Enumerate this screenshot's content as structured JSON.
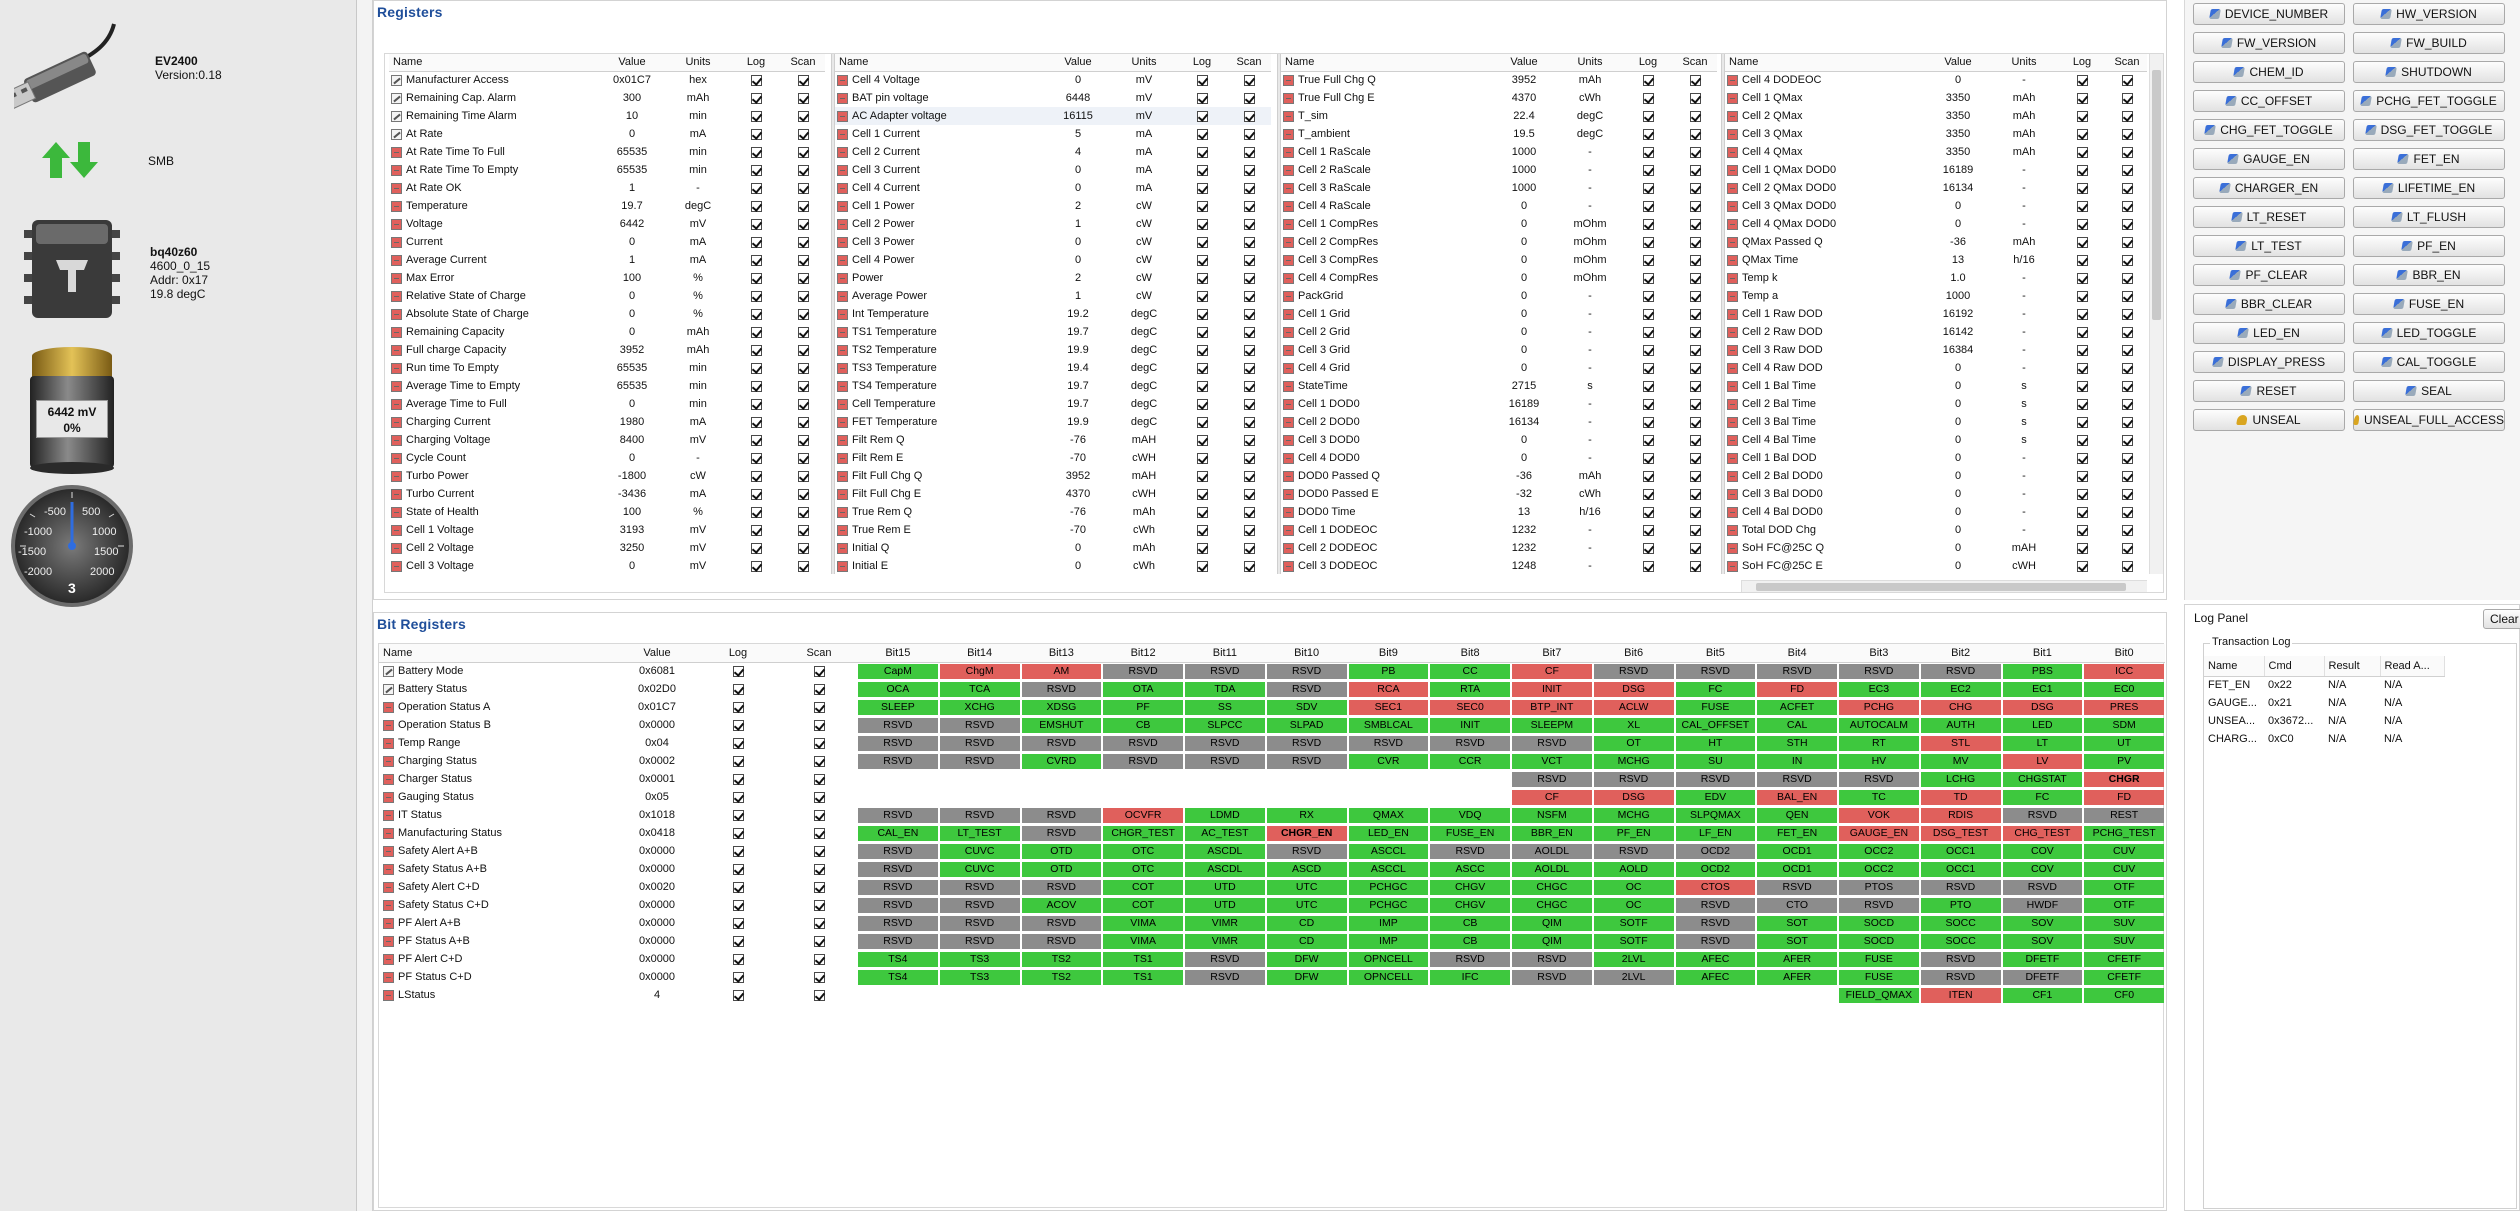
{
  "device": {
    "name": "EV2400",
    "version": "Version:0.18",
    "bus": "SMB",
    "chip": "bq40z60",
    "chip_ver": "4600_0_15",
    "addr": "Addr: 0x17",
    "temp": "19.8 degC",
    "battery_mv": "6442 mV",
    "battery_pct": "0%",
    "battery_level": 0,
    "gauge": {
      "labels": [
        "-500",
        "500",
        "-1000",
        "1000",
        "-1500",
        "1500",
        "-2000",
        "2000"
      ],
      "center": "3"
    }
  },
  "registers": {
    "title": "Registers",
    "headers": [
      "Name",
      "Value",
      "Units",
      "Log",
      "Scan"
    ],
    "cols": [
      [
        [
          "Manufacturer Access",
          "0x01C7",
          "hex"
        ],
        [
          "Remaining Cap. Alarm",
          "300",
          "mAh"
        ],
        [
          "Remaining Time Alarm",
          "10",
          "min"
        ],
        [
          "At Rate",
          "0",
          "mA"
        ],
        [
          "At Rate Time To Full",
          "65535",
          "min"
        ],
        [
          "At Rate Time To Empty",
          "65535",
          "min"
        ],
        [
          "At Rate OK",
          "1",
          "-"
        ],
        [
          "Temperature",
          "19.7",
          "degC"
        ],
        [
          "Voltage",
          "6442",
          "mV"
        ],
        [
          "Current",
          "0",
          "mA"
        ],
        [
          "Average Current",
          "1",
          "mA"
        ],
        [
          "Max Error",
          "100",
          "%"
        ],
        [
          "Relative State of Charge",
          "0",
          "%"
        ],
        [
          "Absolute State of Charge",
          "0",
          "%"
        ],
        [
          "Remaining Capacity",
          "0",
          "mAh"
        ],
        [
          "Full charge Capacity",
          "3952",
          "mAh"
        ],
        [
          "Run time To Empty",
          "65535",
          "min"
        ],
        [
          "Average Time to Empty",
          "65535",
          "min"
        ],
        [
          "Average Time to Full",
          "0",
          "min"
        ],
        [
          "Charging Current",
          "1980",
          "mA"
        ],
        [
          "Charging Voltage",
          "8400",
          "mV"
        ],
        [
          "Cycle Count",
          "0",
          "-"
        ],
        [
          "Turbo Power",
          "-1800",
          "cW"
        ],
        [
          "Turbo Current",
          "-3436",
          "mA"
        ],
        [
          "State of Health",
          "100",
          "%"
        ],
        [
          "Cell 1 Voltage",
          "3193",
          "mV"
        ],
        [
          "Cell 2 Voltage",
          "3250",
          "mV"
        ],
        [
          "Cell 3 Voltage",
          "0",
          "mV"
        ]
      ],
      [
        [
          "Cell 4 Voltage",
          "0",
          "mV"
        ],
        [
          "BAT pin voltage",
          "6448",
          "mV"
        ],
        [
          "AC Adapter voltage",
          "16115",
          "mV"
        ],
        [
          "Cell 1 Current",
          "5",
          "mA"
        ],
        [
          "Cell 2 Current",
          "4",
          "mA"
        ],
        [
          "Cell 3 Current",
          "0",
          "mA"
        ],
        [
          "Cell 4 Current",
          "0",
          "mA"
        ],
        [
          "Cell 1 Power",
          "2",
          "cW"
        ],
        [
          "Cell 2 Power",
          "1",
          "cW"
        ],
        [
          "Cell 3 Power",
          "0",
          "cW"
        ],
        [
          "Cell 4 Power",
          "0",
          "cW"
        ],
        [
          "Power",
          "2",
          "cW"
        ],
        [
          "Average Power",
          "1",
          "cW"
        ],
        [
          "Int Temperature",
          "19.2",
          "degC"
        ],
        [
          "TS1 Temperature",
          "19.7",
          "degC"
        ],
        [
          "TS2 Temperature",
          "19.9",
          "degC"
        ],
        [
          "TS3 Temperature",
          "19.4",
          "degC"
        ],
        [
          "TS4 Temperature",
          "19.7",
          "degC"
        ],
        [
          "Cell Temperature",
          "19.7",
          "degC"
        ],
        [
          "FET Temperature",
          "19.9",
          "degC"
        ],
        [
          "Filt Rem Q",
          "-76",
          "mAH"
        ],
        [
          "Filt Rem E",
          "-70",
          "cWH"
        ],
        [
          "Filt Full Chg Q",
          "3952",
          "mAH"
        ],
        [
          "Filt Full Chg E",
          "4370",
          "cWH"
        ],
        [
          "True Rem Q",
          "-76",
          "mAh"
        ],
        [
          "True Rem E",
          "-70",
          "cWh"
        ],
        [
          "Initial Q",
          "0",
          "mAh"
        ],
        [
          "Initial E",
          "0",
          "cWh"
        ]
      ],
      [
        [
          "True Full Chg Q",
          "3952",
          "mAh"
        ],
        [
          "True Full Chg E",
          "4370",
          "cWh"
        ],
        [
          "T_sim",
          "22.4",
          "degC"
        ],
        [
          "T_ambient",
          "19.5",
          "degC"
        ],
        [
          "Cell 1 RaScale",
          "1000",
          "-"
        ],
        [
          "Cell 2 RaScale",
          "1000",
          "-"
        ],
        [
          "Cell 3 RaScale",
          "1000",
          "-"
        ],
        [
          "Cell 4 RaScale",
          "0",
          "-"
        ],
        [
          "Cell 1 CompRes",
          "0",
          "mOhm"
        ],
        [
          "Cell 2 CompRes",
          "0",
          "mOhm"
        ],
        [
          "Cell 3 CompRes",
          "0",
          "mOhm"
        ],
        [
          "Cell 4 CompRes",
          "0",
          "mOhm"
        ],
        [
          "PackGrid",
          "0",
          "-"
        ],
        [
          "Cell 1 Grid",
          "0",
          "-"
        ],
        [
          "Cell 2 Grid",
          "0",
          "-"
        ],
        [
          "Cell 3 Grid",
          "0",
          "-"
        ],
        [
          "Cell 4 Grid",
          "0",
          "-"
        ],
        [
          "StateTime",
          "2715",
          "s"
        ],
        [
          "Cell 1 DOD0",
          "16189",
          "-"
        ],
        [
          "Cell 2 DOD0",
          "16134",
          "-"
        ],
        [
          "Cell 3 DOD0",
          "0",
          "-"
        ],
        [
          "Cell 4 DOD0",
          "0",
          "-"
        ],
        [
          "DOD0 Passed Q",
          "-36",
          "mAh"
        ],
        [
          "DOD0 Passed E",
          "-32",
          "cWh"
        ],
        [
          "DOD0 Time",
          "13",
          "h/16"
        ],
        [
          "Cell 1 DODEOC",
          "1232",
          "-"
        ],
        [
          "Cell 2 DODEOC",
          "1232",
          "-"
        ],
        [
          "Cell 3 DODEOC",
          "1248",
          "-"
        ]
      ],
      [
        [
          "Cell 4 DODEOC",
          "0",
          "-"
        ],
        [
          "Cell 1 QMax",
          "3350",
          "mAh"
        ],
        [
          "Cell 2 QMax",
          "3350",
          "mAh"
        ],
        [
          "Cell 3 QMax",
          "3350",
          "mAh"
        ],
        [
          "Cell 4 QMax",
          "3350",
          "mAh"
        ],
        [
          "Cell 1 QMax DOD0",
          "16189",
          "-"
        ],
        [
          "Cell 2 QMax DOD0",
          "16134",
          "-"
        ],
        [
          "Cell 3 QMax DOD0",
          "0",
          "-"
        ],
        [
          "Cell 4 QMax DOD0",
          "0",
          "-"
        ],
        [
          "QMax Passed Q",
          "-36",
          "mAh"
        ],
        [
          "QMax Time",
          "13",
          "h/16"
        ],
        [
          "Temp k",
          "1.0",
          "-"
        ],
        [
          "Temp a",
          "1000",
          "-"
        ],
        [
          "Cell 1 Raw DOD",
          "16192",
          "-"
        ],
        [
          "Cell 2 Raw DOD",
          "16142",
          "-"
        ],
        [
          "Cell 3 Raw DOD",
          "16384",
          "-"
        ],
        [
          "Cell 4 Raw DOD",
          "0",
          "-"
        ],
        [
          "Cell 1 Bal Time",
          "0",
          "s"
        ],
        [
          "Cell 2 Bal Time",
          "0",
          "s"
        ],
        [
          "Cell 3 Bal Time",
          "0",
          "s"
        ],
        [
          "Cell 4 Bal Time",
          "0",
          "s"
        ],
        [
          "Cell 1 Bal DOD",
          "0",
          "-"
        ],
        [
          "Cell 2 Bal DOD0",
          "0",
          "-"
        ],
        [
          "Cell 3 Bal DOD0",
          "0",
          "-"
        ],
        [
          "Cell 4 Bal DOD0",
          "0",
          "-"
        ],
        [
          "Total DOD Chg",
          "0",
          "-"
        ],
        [
          "SoH FC@25C Q",
          "0",
          "mAH"
        ],
        [
          "SoH FC@25C E",
          "0",
          "cWH"
        ]
      ]
    ]
  },
  "bitregs": {
    "title": "Bit Registers",
    "headers": [
      "Name",
      "Value",
      "Log",
      "Scan",
      "Bit15",
      "Bit14",
      "Bit13",
      "Bit12",
      "Bit11",
      "Bit10",
      "Bit9",
      "Bit8",
      "Bit7",
      "Bit6",
      "Bit5",
      "Bit4",
      "Bit3",
      "Bit2",
      "Bit1",
      "Bit0"
    ],
    "rows": [
      {
        "name": "Battery Mode",
        "value": "0x6081",
        "bits": [
          "CapM",
          "ChgM",
          "AM",
          "RSVD",
          "RSVD",
          "RSVD",
          "PB",
          "CC",
          "CF",
          "RSVD",
          "RSVD",
          "RSVD",
          "RSVD",
          "RSVD",
          "PBS",
          "ICC"
        ],
        "st": "grrggyggryyyyygr"
      },
      {
        "name": "Battery Status",
        "value": "0x02D0",
        "bits": [
          "OCA",
          "TCA",
          "RSVD",
          "OTA",
          "TDA",
          "RSVD",
          "RCA",
          "RTA",
          "INIT",
          "DSG",
          "FC",
          "FD",
          "EC3",
          "EC2",
          "EC1",
          "EC0"
        ],
        "st": "ggyggyrgrrgrgggg"
      },
      {
        "name": "Operation Status A",
        "value": "0x01C7",
        "bits": [
          "SLEEP",
          "XCHG",
          "XDSG",
          "PF",
          "SS",
          "SDV",
          "SEC1",
          "SEC0",
          "BTP_INT",
          "ACLW",
          "FUSE",
          "ACFET",
          "PCHG",
          "CHG",
          "DSG",
          "PRES"
        ],
        "st": "ggggggrrrrggrrrr"
      },
      {
        "name": "Operation Status B",
        "value": "0x0000",
        "bits": [
          "RSVD",
          "RSVD",
          "EMSHUT",
          "CB",
          "SLPCC",
          "SLPAD",
          "SMBLCAL",
          "INIT",
          "SLEEPM",
          "XL",
          "CAL_OFFSET",
          "CAL",
          "AUTOCALM",
          "AUTH",
          "LED",
          "SDM"
        ],
        "st": "yyggggggggggggggg"
      },
      {
        "name": "Temp Range",
        "value": "0x04",
        "bits": [
          "RSVD",
          "RSVD",
          "RSVD",
          "RSVD",
          "RSVD",
          "RSVD",
          "RSVD",
          "RSVD",
          "RSVD",
          "OT",
          "HT",
          "STH",
          "RT",
          "STL",
          "LT",
          "UT"
        ],
        "st": "yyyyyyyyyggggrgg"
      },
      {
        "name": "Charging Status",
        "value": "0x0002",
        "bits": [
          "RSVD",
          "RSVD",
          "CVRD",
          "RSVD",
          "RSVD",
          "RSVD",
          "CVR",
          "CCR",
          "VCT",
          "MCHG",
          "SU",
          "IN",
          "HV",
          "MV",
          "LV",
          "PV"
        ],
        "st": "yygyyyggggggggrg"
      },
      {
        "name": "Charger Status",
        "value": "0x0001",
        "bits": [
          "",
          "",
          "",
          "",
          "",
          "",
          "",
          "",
          "RSVD",
          "RSVD",
          "RSVD",
          "RSVD",
          "RSVD",
          "LCHG",
          "CHGSTAT",
          "CHGR"
        ],
        "st": "eeeeeeeeyyyyyggR"
      },
      {
        "name": "Gauging Status",
        "value": "0x05",
        "bits": [
          "",
          "",
          "",
          "",
          "",
          "",
          "",
          "",
          "CF",
          "DSG",
          "EDV",
          "BAL_EN",
          "TC",
          "TD",
          "FC",
          "FD"
        ],
        "st": "eeeeeeeerrgrgrgr"
      },
      {
        "name": "IT Status",
        "value": "0x1018",
        "bits": [
          "RSVD",
          "RSVD",
          "RSVD",
          "OCVFR",
          "LDMD",
          "RX",
          "QMAX",
          "VDQ",
          "NSFM",
          "MCHG",
          "SLPQMAX",
          "QEN",
          "VOK",
          "RDIS",
          "RSVD",
          "REST"
        ],
        "st": "yyyrggggggggrrgyg"
      },
      {
        "name": "Manufacturing Status",
        "value": "0x0418",
        "bits": [
          "CAL_EN",
          "LT_TEST",
          "RSVD",
          "CHGR_TEST",
          "AC_TEST",
          "CHGR_EN",
          "LED_EN",
          "FUSE_EN",
          "BBR_EN",
          "PF_EN",
          "LF_EN",
          "FET_EN",
          "GAUGE_EN",
          "DSG_TEST",
          "CHG_TEST",
          "PCHG_TEST"
        ],
        "st": "ggyggRggggggrrrggg"
      },
      {
        "name": "Safety Alert A+B",
        "value": "0x0000",
        "bits": [
          "RSVD",
          "CUVC",
          "OTD",
          "OTC",
          "ASCDL",
          "RSVD",
          "ASCCL",
          "RSVD",
          "AOLDL",
          "RSVD",
          "OCD2",
          "OCD1",
          "OCC2",
          "OCC1",
          "COV",
          "CUV"
        ],
        "st": "yggggyggygyggggg"
      },
      {
        "name": "Safety Status A+B",
        "value": "0x0000",
        "bits": [
          "RSVD",
          "CUVC",
          "OTD",
          "OTC",
          "ASCDL",
          "ASCD",
          "ASCCL",
          "ASCC",
          "AOLDL",
          "AOLD",
          "OCD2",
          "OCD1",
          "OCC2",
          "OCC1",
          "COV",
          "CUV"
        ],
        "st": "yggggggggggggggg"
      },
      {
        "name": "Safety Alert C+D",
        "value": "0x0020",
        "bits": [
          "RSVD",
          "RSVD",
          "RSVD",
          "COT",
          "UTD",
          "UTC",
          "PCHGC",
          "CHGV",
          "CHGC",
          "OC",
          "CTOS",
          "RSVD",
          "PTOS",
          "RSVD",
          "RSVD",
          "OTF"
        ],
        "st": "yyygggggggryyyyg"
      },
      {
        "name": "Safety Status C+D",
        "value": "0x0000",
        "bits": [
          "RSVD",
          "RSVD",
          "ACOV",
          "COT",
          "UTD",
          "UTC",
          "PCHGC",
          "CHGV",
          "CHGC",
          "OC",
          "RSVD",
          "CTO",
          "RSVD",
          "PTO",
          "HWDF",
          "OTF"
        ],
        "st": "yygggggggggyggyggg"
      },
      {
        "name": "PF Alert A+B",
        "value": "0x0000",
        "bits": [
          "RSVD",
          "RSVD",
          "RSVD",
          "VIMA",
          "VIMR",
          "CD",
          "IMP",
          "CB",
          "QIM",
          "SOTF",
          "RSVD",
          "SOT",
          "SOCD",
          "SOCC",
          "SOV",
          "SUV"
        ],
        "st": "yyygggggggygggggg"
      },
      {
        "name": "PF Status A+B",
        "value": "0x0000",
        "bits": [
          "RSVD",
          "RSVD",
          "RSVD",
          "VIMA",
          "VIMR",
          "CD",
          "IMP",
          "CB",
          "QIM",
          "SOTF",
          "RSVD",
          "SOT",
          "SOCD",
          "SOCC",
          "SOV",
          "SUV"
        ],
        "st": "yyygggggggygggggg"
      },
      {
        "name": "PF Alert C+D",
        "value": "0x0000",
        "bits": [
          "TS4",
          "TS3",
          "TS2",
          "TS1",
          "RSVD",
          "DFW",
          "OPNCELL",
          "RSVD",
          "RSVD",
          "2LVL",
          "AFEC",
          "AFER",
          "FUSE",
          "RSVD",
          "DFETF",
          "CFETF"
        ],
        "st": "ggggyggyyggggygg"
      },
      {
        "name": "PF Status C+D",
        "value": "0x0000",
        "bits": [
          "TS4",
          "TS3",
          "TS2",
          "TS1",
          "RSVD",
          "DFW",
          "OPNCELL",
          "IFC",
          "RSVD",
          "2LVL",
          "AFEC",
          "AFER",
          "FUSE",
          "RSVD",
          "DFETF",
          "CFETF"
        ],
        "st": "ggggyggggyggggygg"
      },
      {
        "name": "LStatus",
        "value": "4",
        "bits": [
          "",
          "",
          "",
          "",
          "",
          "",
          "",
          "",
          "",
          "",
          "",
          "",
          "FIELD_QMAX",
          "ITEN",
          "CF1",
          "CF0"
        ],
        "st": "eeeeeeeeeeeegrgg"
      }
    ]
  },
  "commands": {
    "buttons": [
      [
        "DEVICE_NUMBER",
        "HW_VERSION"
      ],
      [
        "FW_VERSION",
        "FW_BUILD"
      ],
      [
        "CHEM_ID",
        "SHUTDOWN"
      ],
      [
        "CC_OFFSET",
        "PCHG_FET_TOGGLE"
      ],
      [
        "CHG_FET_TOGGLE",
        "DSG_FET_TOGGLE"
      ],
      [
        "GAUGE_EN",
        "FET_EN"
      ],
      [
        "CHARGER_EN",
        "LIFETIME_EN"
      ],
      [
        "LT_RESET",
        "LT_FLUSH"
      ],
      [
        "LT_TEST",
        "PF_EN"
      ],
      [
        "PF_CLEAR",
        "BBR_EN"
      ],
      [
        "BBR_CLEAR",
        "FUSE_EN"
      ],
      [
        "LED_EN",
        "LED_TOGGLE"
      ],
      [
        "DISPLAY_PRESS",
        "CAL_TOGGLE"
      ],
      [
        "RESET",
        "SEAL"
      ],
      [
        "UNSEAL",
        "UNSEAL_FULL_ACCESS"
      ]
    ]
  },
  "log": {
    "title": "Log Panel",
    "clear": "Clear",
    "group": "Transaction Log",
    "headers": [
      "Name",
      "Cmd",
      "Result",
      "Read A..."
    ],
    "rows": [
      [
        "FET_EN",
        "0x22",
        "N/A",
        "N/A"
      ],
      [
        "GAUGE...",
        "0x21",
        "N/A",
        "N/A"
      ],
      [
        "UNSEA...",
        "0x3672...",
        "N/A",
        "N/A"
      ],
      [
        "CHARG...",
        "0xC0",
        "N/A",
        "N/A"
      ]
    ]
  },
  "colors": {
    "green": "#3ec83e",
    "red": "#e0605c",
    "gray": "#8c8c8c",
    "title_blue": "#1f4e9a"
  }
}
